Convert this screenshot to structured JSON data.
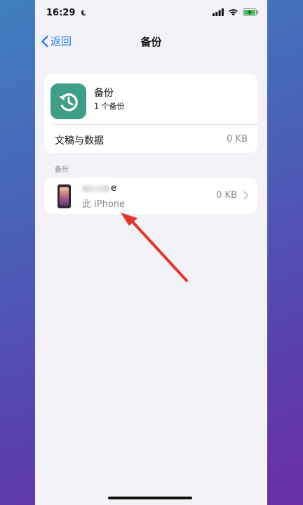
{
  "status_bar": {
    "time": "16:29"
  },
  "nav": {
    "back_label": "返回",
    "title": "备份"
  },
  "app_card": {
    "title": "备份",
    "subtitle": "1 个备份",
    "documents_label": "文稿与数据",
    "documents_size": "0 KB"
  },
  "section_header": "备份",
  "device": {
    "name_suffix": "e",
    "subtitle": "此 iPhone",
    "size": "0 KB"
  },
  "colors": {
    "accent": "#2f7cf6",
    "app_icon": "#3f9e88",
    "annotation_arrow": "#e8342a",
    "battery_fill": "#34c759"
  },
  "icons": {
    "status": [
      "moon-icon",
      "signal-icon",
      "wifi-icon",
      "battery-charging-icon"
    ],
    "nav": "chevron-left-icon",
    "app": "restore-backup-icon",
    "row": "chevron-right-icon"
  }
}
